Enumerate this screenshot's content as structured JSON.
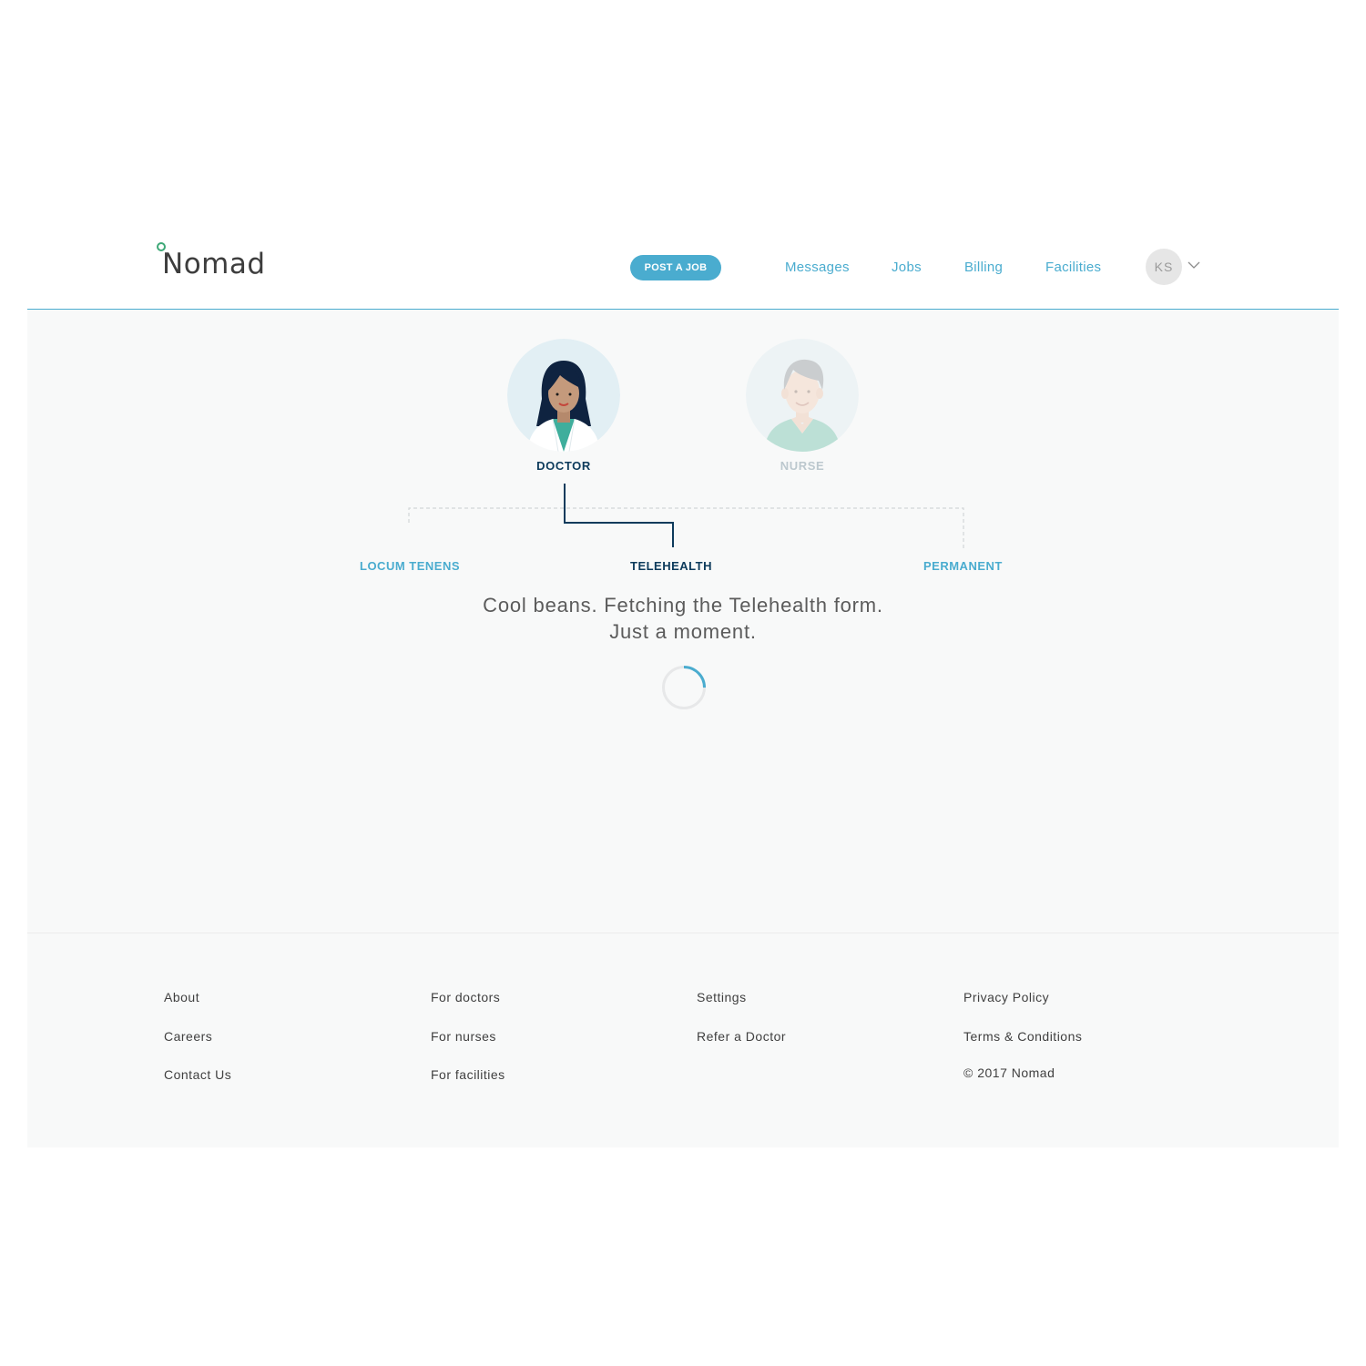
{
  "brand": {
    "name": "Nomad",
    "dot_color": "#3ea877",
    "accent_color": "#4aaccf",
    "dark_color": "#0d3b5c"
  },
  "header": {
    "post_job_label": "POST A JOB",
    "nav": [
      "Messages",
      "Jobs",
      "Billing",
      "Facilities"
    ],
    "user_initials": "KS",
    "user_menu_icon": "chevron-down-icon"
  },
  "main": {
    "roles": [
      {
        "label": "DOCTOR",
        "selected": true,
        "icon": "doctor-avatar-icon"
      },
      {
        "label": "NURSE",
        "selected": false,
        "icon": "nurse-avatar-icon"
      }
    ],
    "options": [
      {
        "label": "LOCUM TENENS",
        "selected": false
      },
      {
        "label": "TELEHEALTH",
        "selected": true
      },
      {
        "label": "PERMANENT",
        "selected": false
      }
    ],
    "loading_line1": "Cool beans. Fetching the Telehealth form.",
    "loading_line2": "Just a moment.",
    "spinner_icon": "loading-spinner-icon"
  },
  "footer": {
    "col1": [
      "About",
      "Careers",
      "Contact Us"
    ],
    "col2": [
      "For doctors",
      "For nurses",
      "For facilities"
    ],
    "col3": [
      "Settings",
      "Refer a Doctor"
    ],
    "col4": [
      "Privacy Policy",
      "Terms & Conditions"
    ],
    "copyright": "© 2017 Nomad"
  }
}
